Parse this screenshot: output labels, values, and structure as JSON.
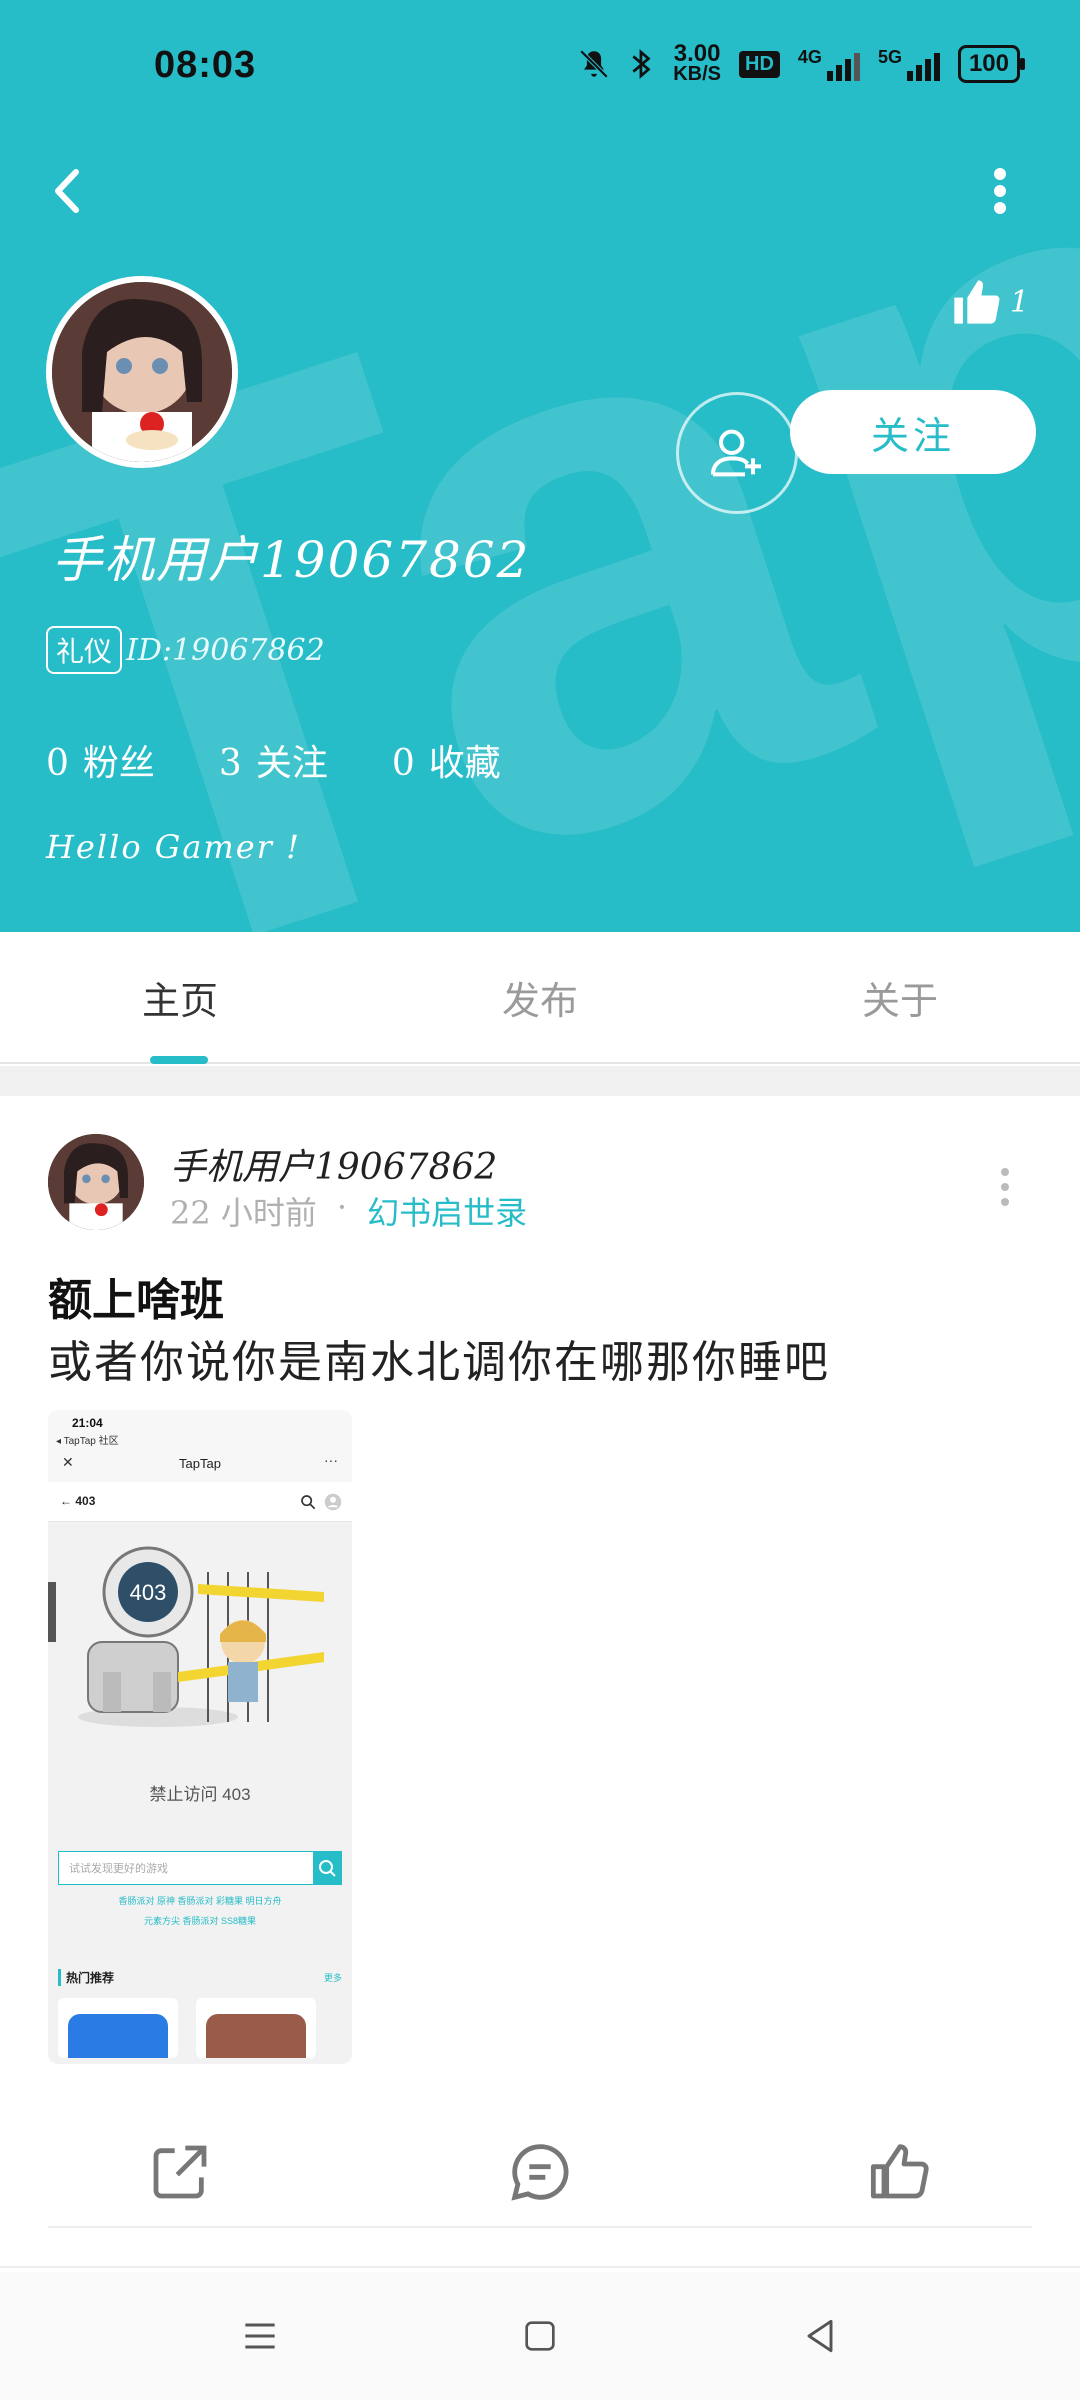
{
  "status_bar": {
    "time": "08:03",
    "net_speed_value": "3.00",
    "net_speed_unit": "KB/S",
    "hd_label": "HD",
    "sig1_label": "4G",
    "sig2_label": "5G",
    "battery": "100",
    "icons": [
      "mute-icon",
      "bluetooth-icon"
    ]
  },
  "header": {
    "bg_color": "#26bcc8",
    "like_count": "1",
    "follow_label": "关注",
    "username": "手机用户19067862",
    "badge": "礼仪",
    "user_id": "ID:19067862",
    "stats": [
      {
        "count": "0",
        "label": "粉丝"
      },
      {
        "count": "3",
        "label": "关注"
      },
      {
        "count": "0",
        "label": "收藏"
      }
    ],
    "bio": "Hello  Gamer  !"
  },
  "tabs": [
    {
      "label": "主页",
      "active": true
    },
    {
      "label": "发布",
      "active": false
    },
    {
      "label": "关于",
      "active": false
    }
  ],
  "post": {
    "author": "手机用户19067862",
    "time_ago": "22 小时前",
    "separator": "·",
    "forum": "幻书启世录",
    "title": "额上啥班",
    "body": "或者你说你是南水北调你在哪那你睡吧",
    "screenshot": {
      "time": "21:04",
      "back_app": "◂ TapTap 社区",
      "title": "TapTap",
      "nav_label": "403",
      "illus_number": "403",
      "forbidden_text": "禁止访问 403",
      "search_placeholder": "试试发现更好的游戏",
      "tags_line1": "香肠派对   原神   香肠派对 彩糖果   明日方舟",
      "tags_line2": "元素方尖   香肠派对 SS8糖果",
      "hot_label": "热门推荐",
      "more_label": "更多"
    }
  },
  "actions": [
    "share-icon",
    "comment-icon",
    "like-icon"
  ],
  "nav_bar": [
    "menu-icon",
    "home-icon",
    "back-icon"
  ]
}
